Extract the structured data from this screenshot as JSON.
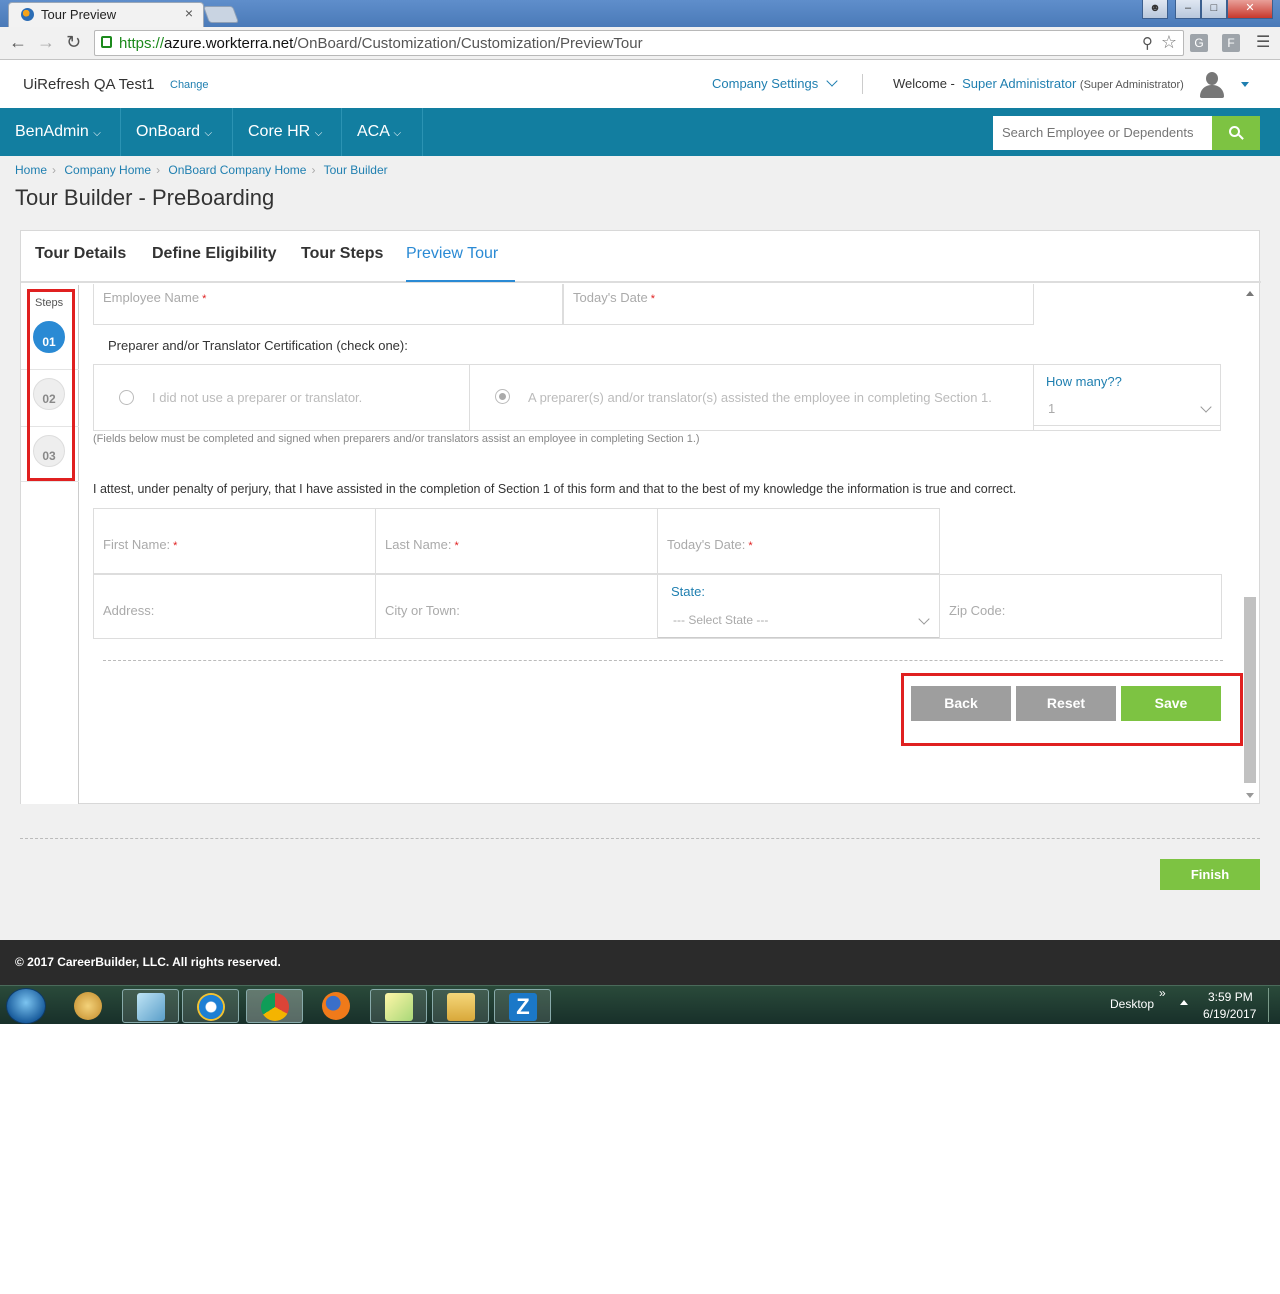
{
  "browser": {
    "tab_title": "Tour Preview",
    "tab_close": "×",
    "url_scheme": "https://",
    "url_host": "azure.workterra.net",
    "url_path": "/OnBoard/Customization/Customization/PreviewTour"
  },
  "header": {
    "company_name": "UiRefresh QA Test1",
    "change_label": "Change",
    "company_settings_label": "Company Settings",
    "welcome_label": "Welcome -",
    "user_name": "Super Administrator",
    "user_role": "(Super Administrator)"
  },
  "nav": {
    "items": [
      {
        "label": "BenAdmin"
      },
      {
        "label": "OnBoard"
      },
      {
        "label": "Core HR"
      },
      {
        "label": "ACA"
      }
    ],
    "search_placeholder": "Search Employee or Dependents"
  },
  "breadcrumb": [
    "Home",
    "Company Home",
    "OnBoard Company Home",
    "Tour Builder"
  ],
  "page_title": "Tour Builder - PreBoarding",
  "tabs": [
    {
      "label": "Tour Details",
      "active": false
    },
    {
      "label": "Define Eligibility",
      "active": false
    },
    {
      "label": "Tour Steps",
      "active": false
    },
    {
      "label": "Preview Tour",
      "active": true
    }
  ],
  "steps": {
    "label": "Steps",
    "items": [
      {
        "number": "01",
        "active": true
      },
      {
        "number": "02",
        "active": false
      },
      {
        "number": "03",
        "active": false
      }
    ]
  },
  "form": {
    "employee_name_label": "Employee Name",
    "todays_date_label": "Today's Date",
    "required_mark": "*",
    "certification_heading": "Preparer and/or Translator Certification (check one):",
    "option_no_preparer": "I did not use a preparer or translator.",
    "option_preparer": "A preparer(s) and/or translator(s) assisted the employee in completing Section 1.",
    "how_many_label": "How many??",
    "how_many_value": "1",
    "fields_note": "(Fields below must be completed and signed when preparers and/or translators assist an employee in completing Section 1.)",
    "attest_text": "I attest, under penalty of perjury, that I have assisted in the completion of Section 1 of this form and that to the best of my knowledge the information is true and correct.",
    "first_name_label": "First Name:",
    "last_name_label": "Last Name:",
    "todays_date2_label": "Today's Date:",
    "address_label": "Address:",
    "city_label": "City or Town:",
    "state_label": "State:",
    "state_placeholder": "--- Select State ---",
    "zip_label": "Zip Code:"
  },
  "actions": {
    "back": "Back",
    "reset": "Reset",
    "save": "Save",
    "finish": "Finish"
  },
  "footer": "© 2017 CareerBuilder, LLC. All rights reserved.",
  "taskbar": {
    "desktop_label": "Desktop",
    "time": "3:59 PM",
    "date": "6/19/2017",
    "z_label": "Z"
  },
  "colors": {
    "brand_nav": "#127ea0",
    "accent_green": "#7dc342",
    "accent_blue": "#2a8ad4",
    "highlight_red": "#e02020"
  }
}
